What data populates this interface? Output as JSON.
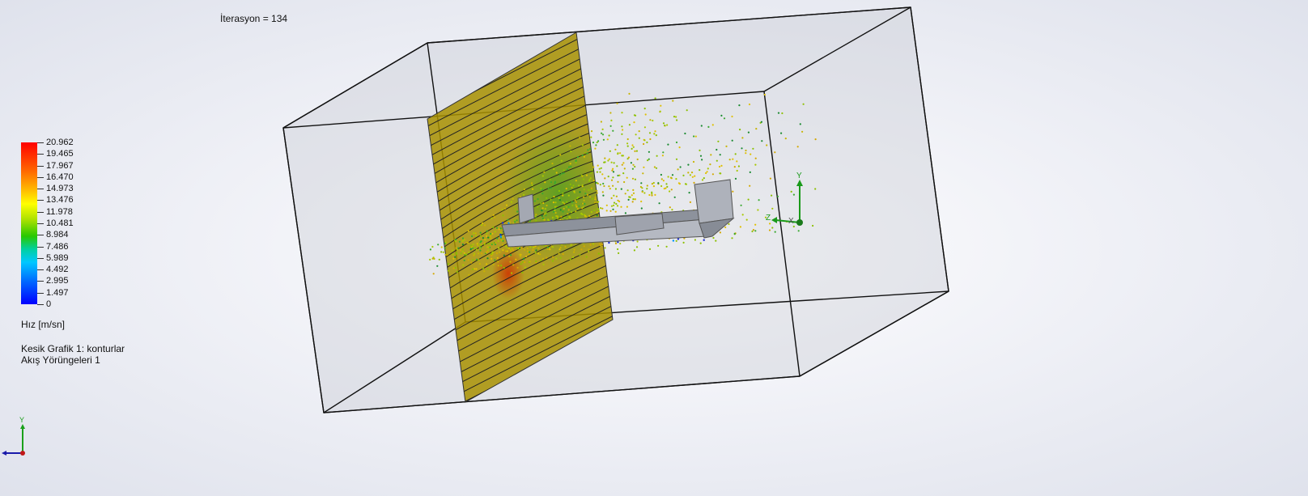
{
  "iteration_label": "İterasyon = 134",
  "legend": {
    "title": "Hız [m/sn]",
    "ticks": [
      "20.962",
      "19.465",
      "17.967",
      "16.470",
      "14.973",
      "13.476",
      "11.978",
      "10.481",
      "8.984",
      "7.486",
      "5.989",
      "4.492",
      "2.995",
      "1.497",
      "0"
    ]
  },
  "plots": [
    "Kesik Grafik 1: konturlar",
    "Akış Yörüngeleri 1"
  ],
  "triad_main": {
    "y": "Y",
    "z": "Z",
    "x": "X"
  },
  "triad_corner": {
    "y": "Y"
  },
  "colors": {
    "cut_plot": "#a89000",
    "part": "#9ea3ad",
    "box_edge": "#111111"
  }
}
